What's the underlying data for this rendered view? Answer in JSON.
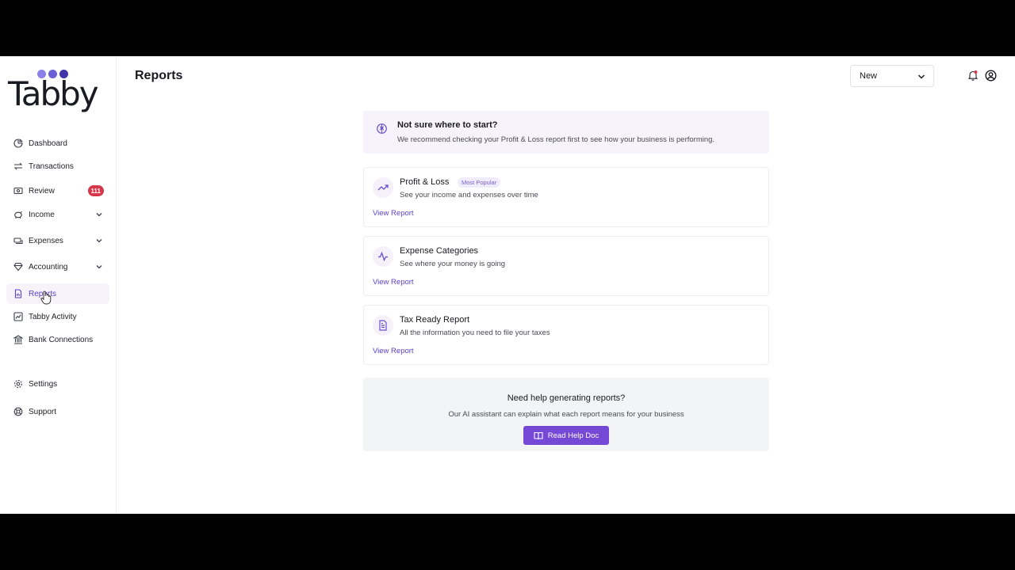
{
  "app": {
    "name": "Tabby"
  },
  "brand": {
    "dot_colors": [
      "#8b80e8",
      "#6b5fd8",
      "#3f35a8"
    ],
    "accent": "#5b41c8",
    "button": "#7548d6",
    "badge": "#d8364a"
  },
  "sidebar": {
    "items": [
      {
        "label": "Dashboard",
        "icon": "dashboard-icon"
      },
      {
        "label": "Transactions",
        "icon": "arrows-swap-icon"
      },
      {
        "label": "Review",
        "icon": "review-icon",
        "badge": "111"
      },
      {
        "label": "Income",
        "icon": "piggy-bank-icon",
        "expandable": true
      },
      {
        "label": "Expenses",
        "icon": "cash-icon",
        "expandable": true
      },
      {
        "label": "Accounting",
        "icon": "diamond-icon",
        "expandable": true
      },
      {
        "label": "Reports",
        "icon": "report-icon",
        "active": true
      },
      {
        "label": "Tabby Activity",
        "icon": "chart-icon"
      },
      {
        "label": "Bank Connections",
        "icon": "bank-icon"
      },
      {
        "label": "Settings",
        "icon": "gear-icon"
      },
      {
        "label": "Support",
        "icon": "lifebuoy-icon"
      }
    ]
  },
  "header": {
    "title": "Reports",
    "new_select": "New"
  },
  "tip": {
    "title": "Not sure where to start?",
    "text": "We recommend checking your Profit & Loss report first to see how your business is performing."
  },
  "reports": [
    {
      "title": "Profit & Loss",
      "tag": "Most Popular",
      "description": "See your income and expenses over time",
      "link": "View Report",
      "icon": "trend-up-icon"
    },
    {
      "title": "Expense Categories",
      "description": "See where your money is going",
      "link": "View Report",
      "icon": "pulse-icon"
    },
    {
      "title": "Tax Ready Report",
      "description": "All the information you need to file your taxes",
      "link": "View Report",
      "icon": "document-icon"
    }
  ],
  "help": {
    "title": "Need help generating reports?",
    "text": "Our AI assistant can explain what each report means for your business",
    "button": "Read Help Doc"
  }
}
